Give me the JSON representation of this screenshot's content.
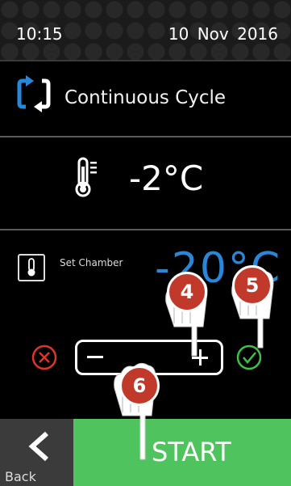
{
  "status_bar": {
    "time": "10:15",
    "date": "10 Nov 2016"
  },
  "cycle": {
    "icon": "refresh-cycle-icon",
    "label": "Continuous Cycle",
    "color": "#2a86d6"
  },
  "temperature": {
    "icon": "thermometer-icon",
    "value": "-2°C"
  },
  "set_chamber": {
    "icon": "thermometer-box-icon",
    "label": "Set Chamber",
    "setpoint": "-20°C",
    "setpoint_color": "#2a86d6"
  },
  "controls": {
    "cancel_icon": "x-circle-icon",
    "confirm_icon": "check-circle-icon",
    "minus_icon": "minus-icon",
    "plus_icon": "plus-icon",
    "cancel_color": "#e0342b",
    "confirm_color": "#3cc14a"
  },
  "bottom_bar": {
    "back_label": "Back",
    "start_label": "START",
    "start_color": "#4fc45e",
    "back_color": "#3b3b3b"
  },
  "callouts": [
    {
      "number": "4",
      "icon": "pointing-hand-icon"
    },
    {
      "number": "5",
      "icon": "pointing-hand-icon"
    },
    {
      "number": "6",
      "icon": "pointing-hand-icon"
    }
  ]
}
